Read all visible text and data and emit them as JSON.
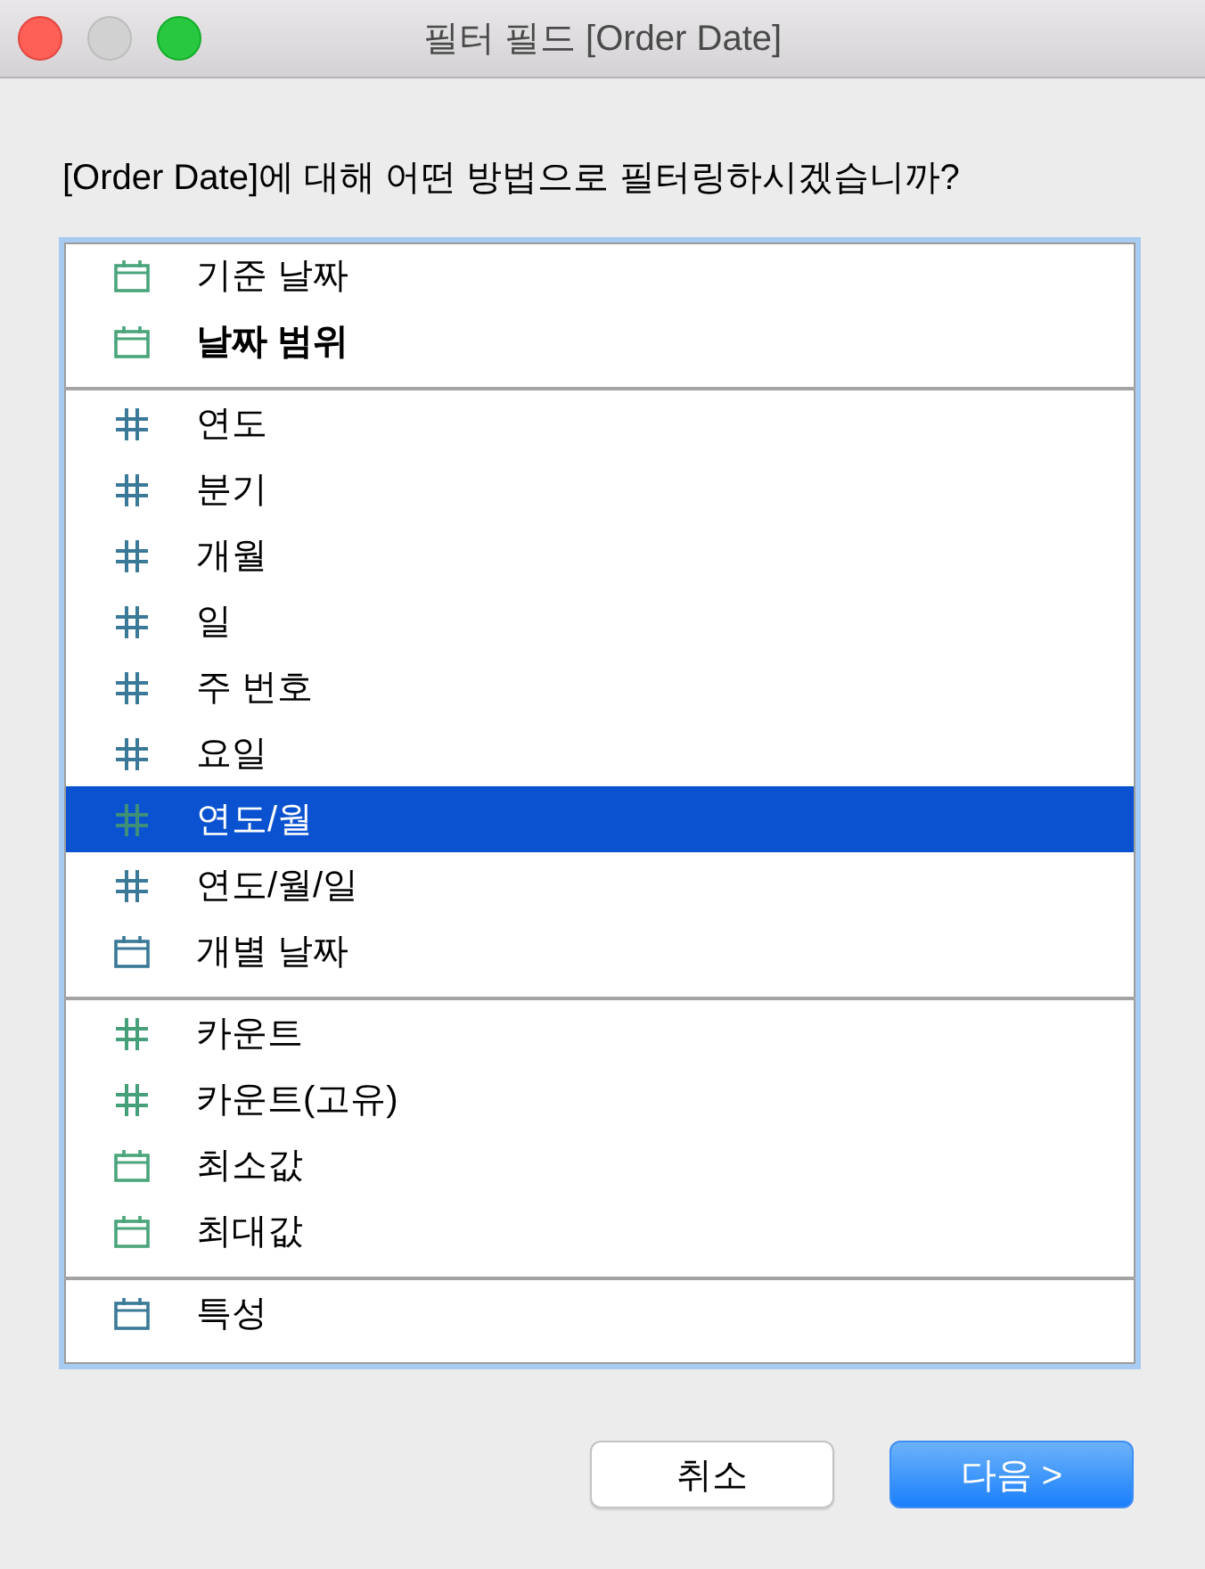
{
  "window": {
    "title": "필터 필드 [Order Date]",
    "buttons": [
      {
        "kind": "close",
        "disabled": false
      },
      {
        "kind": "minimize",
        "disabled": true
      },
      {
        "kind": "zoom",
        "disabled": false
      }
    ]
  },
  "question": "[Order Date]에 대해 어떤 방법으로 필터링하시겠습니까?",
  "list": {
    "groups": [
      {
        "items": [
          {
            "label": "기준 날짜",
            "kind": "date",
            "color": "#4aa57b",
            "bold": false,
            "selected": false
          },
          {
            "label": "날짜 범위",
            "kind": "date",
            "color": "#4aa57b",
            "bold": true,
            "selected": false
          }
        ]
      },
      {
        "items": [
          {
            "label": "연도",
            "kind": "number",
            "color": "#3a7a98",
            "bold": false,
            "selected": false
          },
          {
            "label": "분기",
            "kind": "number",
            "color": "#3a7a98",
            "bold": false,
            "selected": false
          },
          {
            "label": "개월",
            "kind": "number",
            "color": "#3a7a98",
            "bold": false,
            "selected": false
          },
          {
            "label": "일",
            "kind": "number",
            "color": "#3a7a98",
            "bold": false,
            "selected": false
          },
          {
            "label": "주 번호",
            "kind": "number",
            "color": "#3a7a98",
            "bold": false,
            "selected": false
          },
          {
            "label": "요일",
            "kind": "number",
            "color": "#3a7a98",
            "bold": false,
            "selected": false
          },
          {
            "label": "연도/월",
            "kind": "number",
            "color": "#3d8f7b",
            "bold": false,
            "selected": true
          },
          {
            "label": "연도/월/일",
            "kind": "number",
            "color": "#3a7a98",
            "bold": false,
            "selected": false
          },
          {
            "label": "개별 날짜",
            "kind": "date",
            "color": "#3a7a98",
            "bold": false,
            "selected": false
          }
        ]
      },
      {
        "items": [
          {
            "label": "카운트",
            "kind": "number",
            "color": "#45a07a",
            "bold": false,
            "selected": false
          },
          {
            "label": "카운트(고유)",
            "kind": "number",
            "color": "#45a07a",
            "bold": false,
            "selected": false
          },
          {
            "label": "최소값",
            "kind": "date",
            "color": "#4aa57b",
            "bold": false,
            "selected": false
          },
          {
            "label": "최대값",
            "kind": "date",
            "color": "#4aa57b",
            "bold": false,
            "selected": false
          }
        ]
      },
      {
        "items": [
          {
            "label": "특성",
            "kind": "date",
            "color": "#3a7a98",
            "bold": false,
            "selected": false
          }
        ]
      }
    ]
  },
  "buttons": [
    {
      "label": "취소",
      "kind": "secondary"
    },
    {
      "label": "다음 >",
      "kind": "primary"
    }
  ]
}
